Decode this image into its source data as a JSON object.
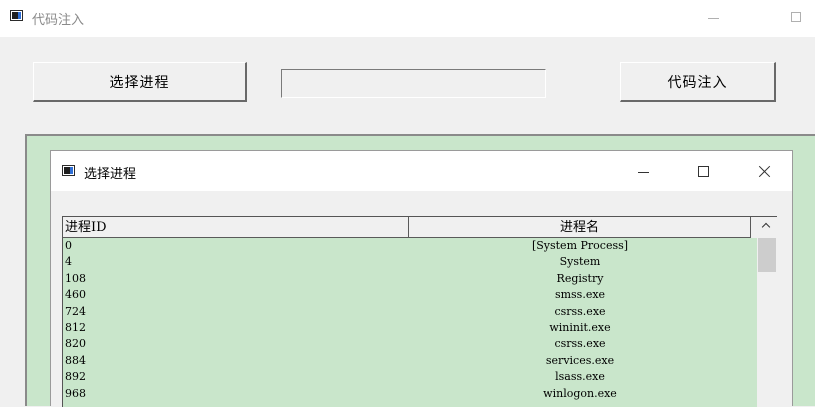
{
  "window": {
    "title": "代码注入"
  },
  "toolbar": {
    "select_process_label": "选择进程",
    "process_field_value": "",
    "inject_label": "代码注入"
  },
  "dialog": {
    "title": "选择进程",
    "columns": {
      "pid": "进程ID",
      "name": "进程名"
    },
    "rows": [
      {
        "pid": "0",
        "name": "[System Process]"
      },
      {
        "pid": "4",
        "name": "System"
      },
      {
        "pid": "108",
        "name": "Registry"
      },
      {
        "pid": "460",
        "name": "smss.exe"
      },
      {
        "pid": "724",
        "name": "csrss.exe"
      },
      {
        "pid": "812",
        "name": "wininit.exe"
      },
      {
        "pid": "820",
        "name": "csrss.exe"
      },
      {
        "pid": "884",
        "name": "services.exe"
      },
      {
        "pid": "892",
        "name": "lsass.exe"
      },
      {
        "pid": "968",
        "name": "winlogon.exe"
      }
    ]
  },
  "colors": {
    "panel_green": "#c9e6cb",
    "window_bg": "#f0f0f0"
  },
  "icons": [
    "app-icon",
    "minimize-icon",
    "maximize-icon",
    "close-icon",
    "scroll-up-icon"
  ]
}
